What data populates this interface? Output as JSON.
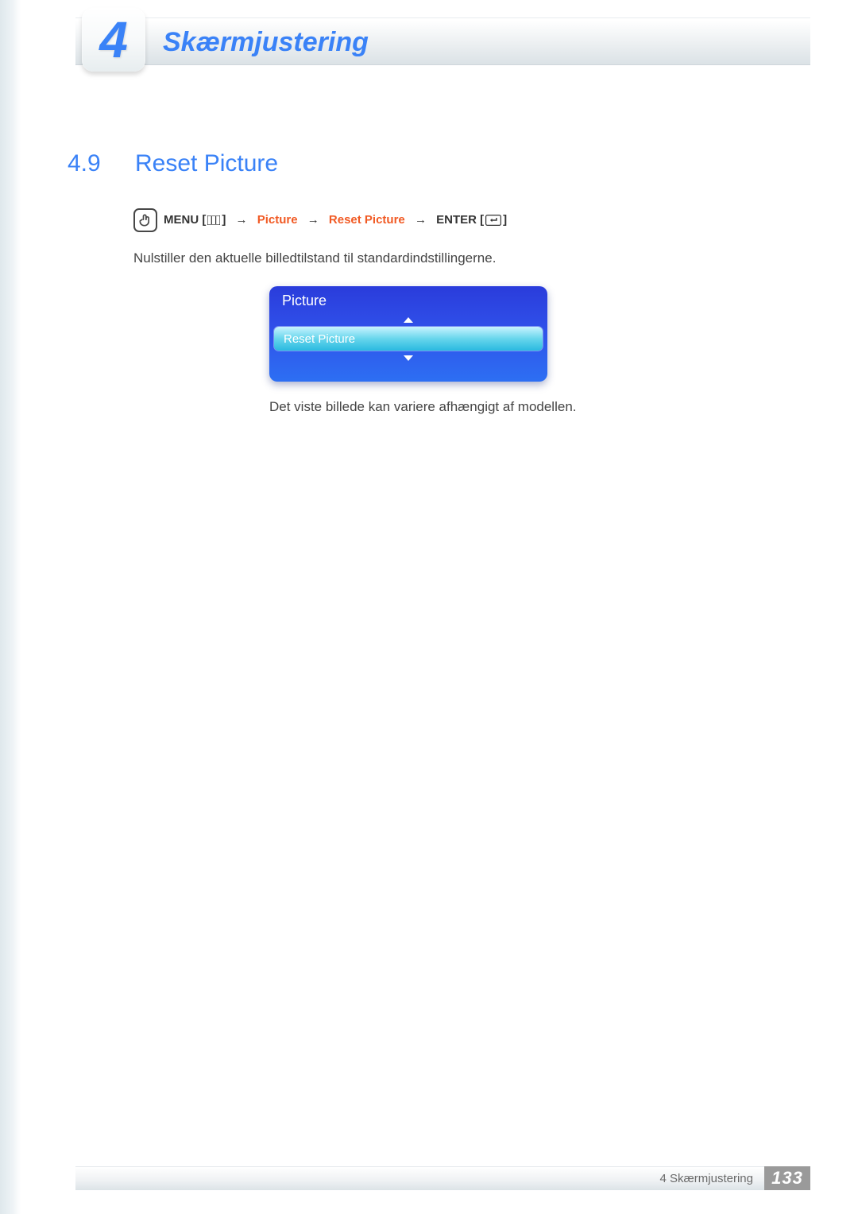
{
  "header": {
    "chapter_tab_number": "4",
    "chapter_title": "Skærmjustering"
  },
  "section": {
    "number": "4.9",
    "title": "Reset Picture"
  },
  "nav_path": {
    "menu_label": "MENU",
    "menu_bracket_open": "[",
    "menu_bracket_close": "]",
    "step1": "Picture",
    "step2": "Reset Picture",
    "enter_label": "ENTER",
    "enter_bracket_open": "[",
    "enter_bracket_close": "]"
  },
  "body": {
    "description": "Nulstiller den aktuelle billedtilstand til standardindstillingerne.",
    "note": "Det viste billede kan variere afhængigt af modellen."
  },
  "osd": {
    "title": "Picture",
    "selected_item": "Reset Picture"
  },
  "footer": {
    "breadcrumb": "4 Skærmjustering",
    "page_number": "133"
  }
}
